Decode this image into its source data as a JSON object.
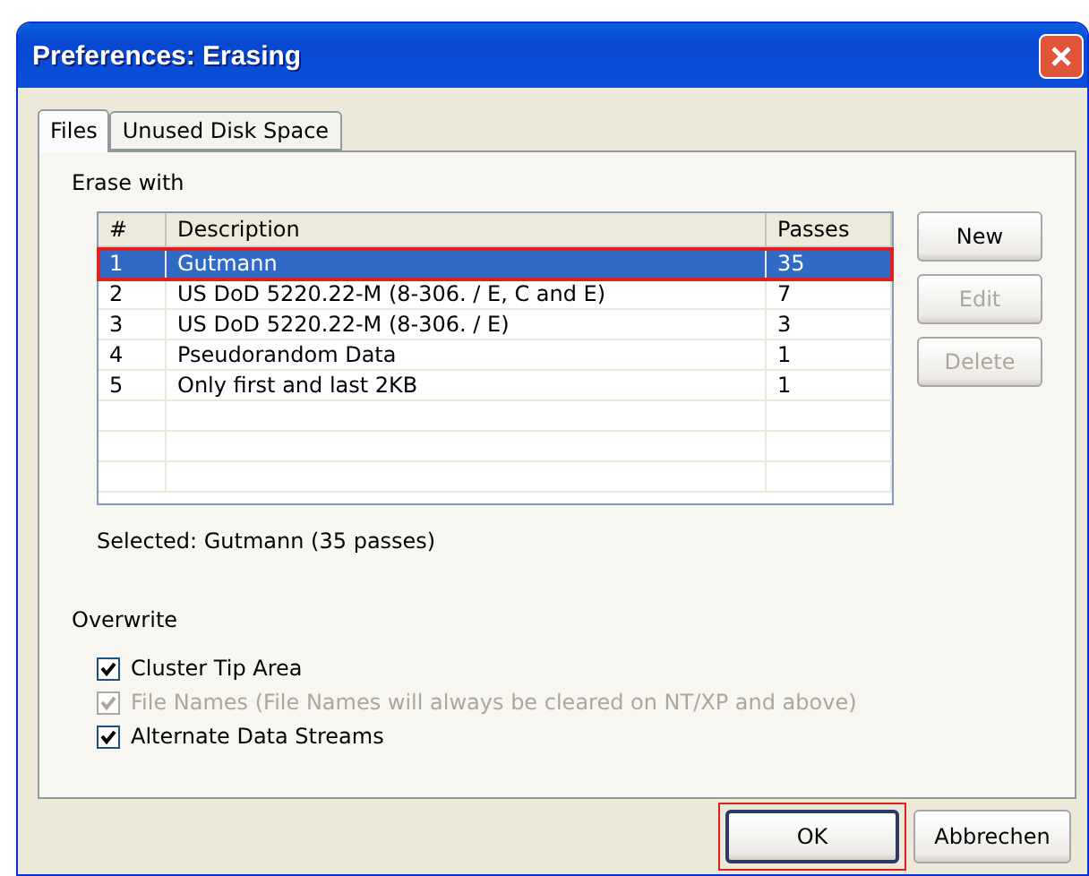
{
  "window": {
    "title": "Preferences: Erasing"
  },
  "tabs": [
    {
      "label": "Files",
      "selected": true
    },
    {
      "label": "Unused Disk Space",
      "selected": false
    }
  ],
  "erase_with": {
    "label": "Erase with",
    "columns": [
      "#",
      "Description",
      "Passes"
    ],
    "rows": [
      {
        "cells": [
          "1",
          "Gutmann",
          "35"
        ],
        "selected": true,
        "highlighted": true
      },
      {
        "cells": [
          "2",
          "US DoD 5220.22-M (8-306. / E, C and E)",
          "7"
        ],
        "selected": false,
        "highlighted": false
      },
      {
        "cells": [
          "3",
          "US DoD 5220.22-M (8-306. / E)",
          "3"
        ],
        "selected": false,
        "highlighted": false
      },
      {
        "cells": [
          "4",
          "Pseudorandom Data",
          "1"
        ],
        "selected": false,
        "highlighted": false
      },
      {
        "cells": [
          "5",
          "Only first and last 2KB",
          "1"
        ],
        "selected": false,
        "highlighted": false
      }
    ],
    "buttons": [
      {
        "label": "New",
        "disabled": false
      },
      {
        "label": "Edit",
        "disabled": true
      },
      {
        "label": "Delete",
        "disabled": true
      }
    ],
    "selected_text": "Selected: Gutmann (35 passes)"
  },
  "overwrite": {
    "label": "Overwrite",
    "options": [
      {
        "label": "Cluster Tip Area",
        "checked": true,
        "disabled": false
      },
      {
        "label": "File Names (File Names will always be cleared on NT/XP and above)",
        "checked": true,
        "disabled": true
      },
      {
        "label": "Alternate Data Streams",
        "checked": true,
        "disabled": false
      }
    ]
  },
  "footer_buttons": [
    {
      "label": "OK",
      "default": true,
      "highlighted": true
    },
    {
      "label": "Abbrechen",
      "default": false,
      "highlighted": false
    }
  ]
}
